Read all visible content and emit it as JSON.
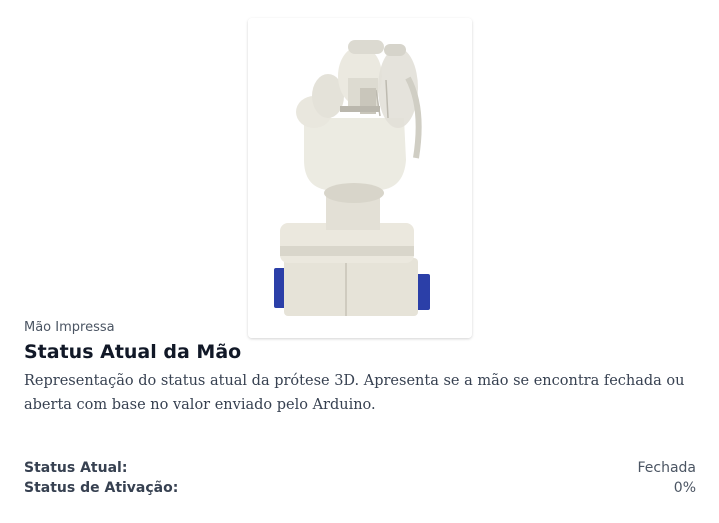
{
  "card": {
    "eyebrow": "Mão Impressa",
    "title": "Status Atual da Mão",
    "description": "Representação do status atual da prótese 3D. Apresenta se a mão se encontra fechada ou aberta com base no valor enviado pelo Arduino."
  },
  "status": {
    "current_label": "Status Atual:",
    "current_value": "Fechada",
    "activation_label": "Status de Ativação:",
    "activation_value": "0%"
  },
  "image": {
    "icon": "prosthetic-hand-image"
  }
}
